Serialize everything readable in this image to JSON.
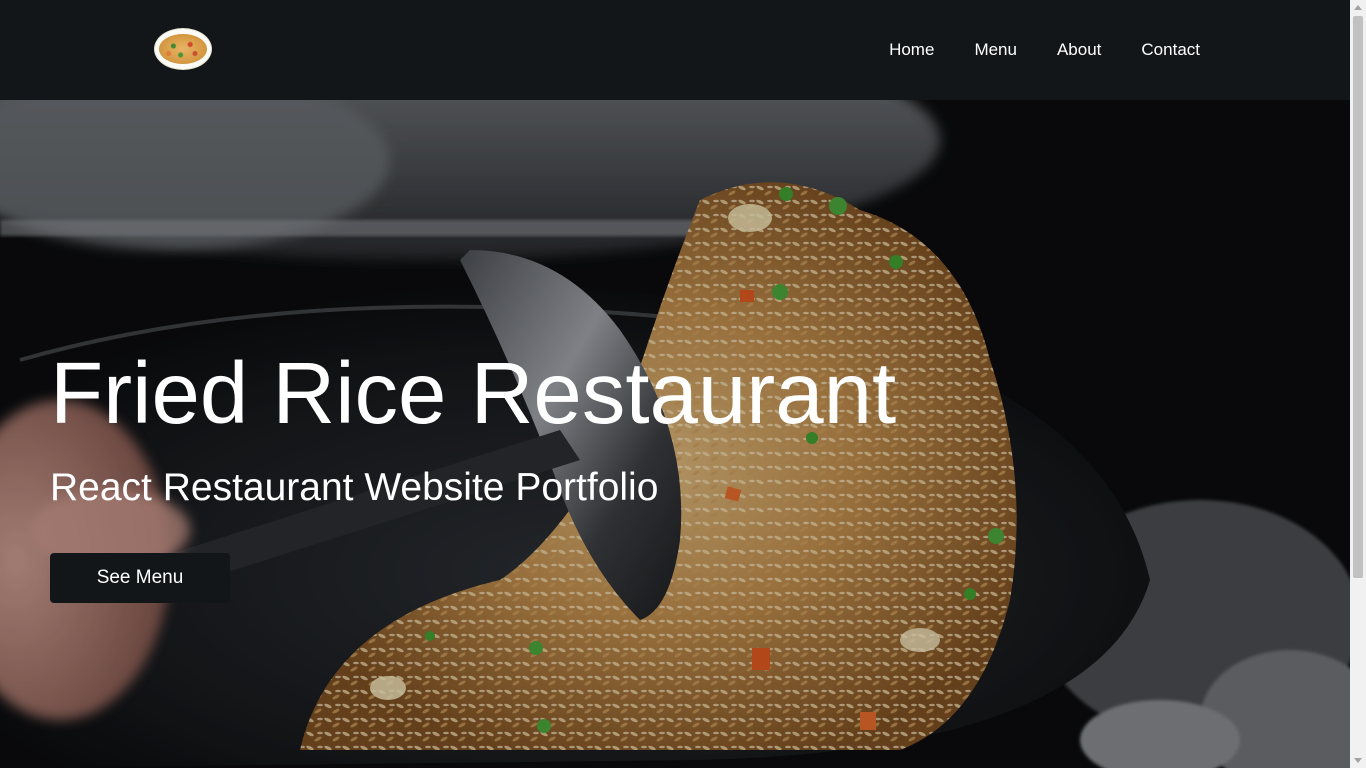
{
  "navbar": {
    "logo_icon": "fried-rice-plate-logo",
    "links": [
      "Home",
      "Menu",
      "About",
      "Contact"
    ]
  },
  "hero": {
    "title": "Fried Rice Restaurant",
    "subtitle": "React Restaurant Website Portfolio",
    "button_label": "See Menu",
    "background_image": "fried-rice-in-wok-photo"
  },
  "colors": {
    "navbar_bg": "#121619",
    "button_bg": "#121619",
    "text": "#ffffff"
  }
}
